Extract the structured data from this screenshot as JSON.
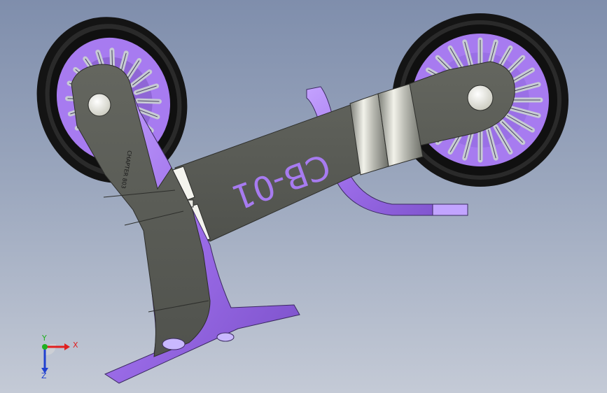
{
  "viewport": {
    "part_label": "CB-01",
    "small_engraving": "CHAPTER 803"
  },
  "triad": {
    "x_label": "X",
    "y_label": "Y",
    "z_label": "Z"
  },
  "colors": {
    "background_top": "#7f8eac",
    "background_bottom": "#c4cad6",
    "arm_gray": "#5b5d58",
    "bracket_purple": "#a77bf0",
    "tire_black": "#141414",
    "axis_x": "#e02020",
    "axis_y": "#20b020",
    "axis_z": "#2040d0"
  }
}
